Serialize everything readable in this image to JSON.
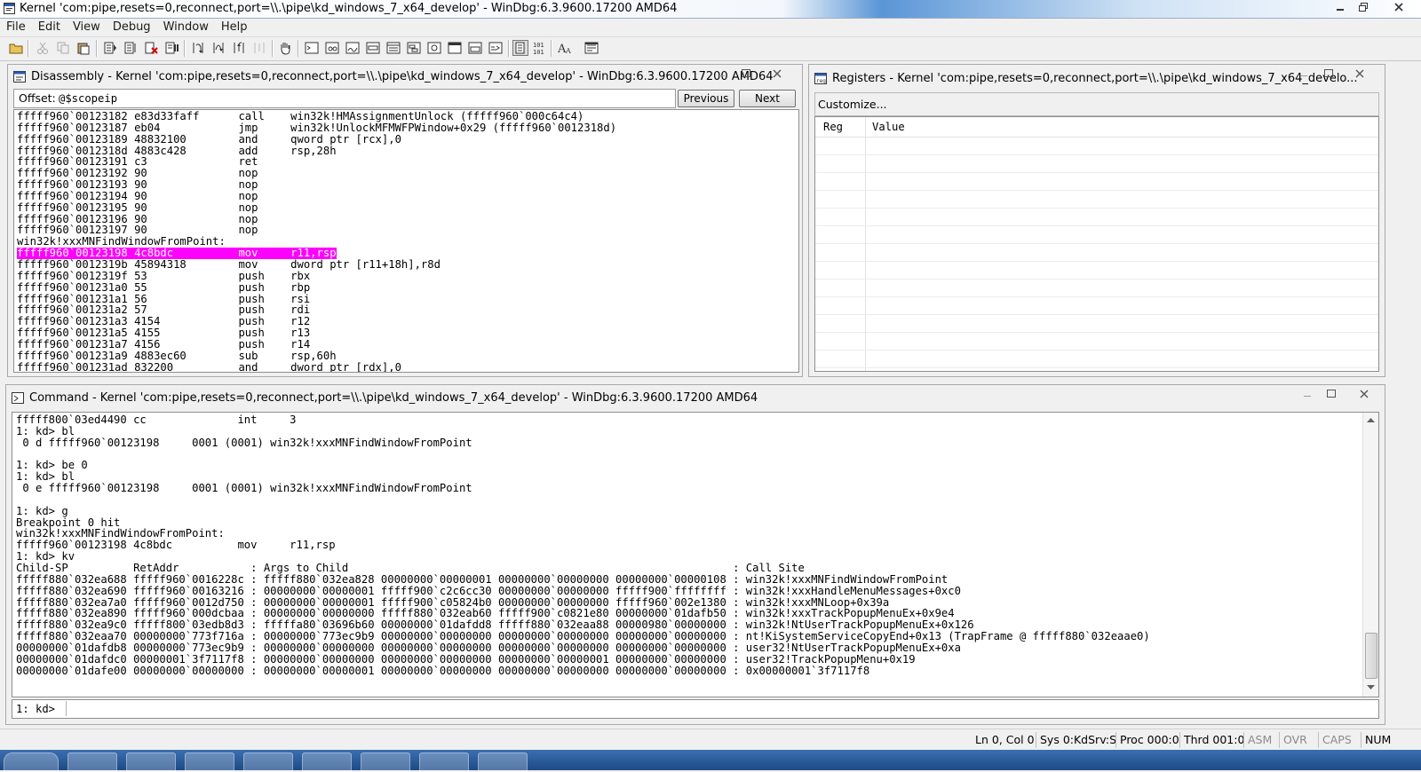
{
  "app": {
    "title": "Kernel 'com:pipe,resets=0,reconnect,port=\\\\.\\pipe\\kd_windows_7_x64_develop' - WinDbg:6.3.9600.17200 AMD64"
  },
  "menu": [
    "File",
    "Edit",
    "View",
    "Debug",
    "Window",
    "Help"
  ],
  "disassembly": {
    "title": "Disassembly - Kernel 'com:pipe,resets=0,reconnect,port=\\\\.\\pipe\\kd_windows_7_x64_develop' - WinDbg:6.3.9600.17200 AMD64",
    "offset_label": "Offset:",
    "offset_value": "@$scopeip",
    "previous_label": "Previous",
    "next_label": "Next",
    "lines": [
      "fffff960`00123182 e83d33faff      call    win32k!HMAssignmentUnlock (fffff960`000c64c4)",
      "fffff960`00123187 eb04            jmp     win32k!UnlockMFMWFPWindow+0x29 (fffff960`0012318d)",
      "fffff960`00123189 48832100        and     qword ptr [rcx],0",
      "fffff960`0012318d 4883c428        add     rsp,28h",
      "fffff960`00123191 c3              ret",
      "fffff960`00123192 90              nop",
      "fffff960`00123193 90              nop",
      "fffff960`00123194 90              nop",
      "fffff960`00123195 90              nop",
      "fffff960`00123196 90              nop",
      "fffff960`00123197 90              nop",
      "win32k!xxxMNFindWindowFromPoint:",
      "fffff960`00123198 4c8bdc          mov     r11,rsp",
      "fffff960`0012319b 45894318        mov     dword ptr [r11+18h],r8d",
      "fffff960`0012319f 53              push    rbx",
      "fffff960`001231a0 55              push    rbp",
      "fffff960`001231a1 56              push    rsi",
      "fffff960`001231a2 57              push    rdi",
      "fffff960`001231a3 4154            push    r12",
      "fffff960`001231a5 4155            push    r13",
      "fffff960`001231a7 4156            push    r14",
      "fffff960`001231a9 4883ec60        sub     rsp,60h",
      "fffff960`001231ad 832200          and     dword ptr [rdx],0"
    ],
    "highlight_index": 12,
    "highlight_color": "#ff00ff"
  },
  "registers": {
    "title": "Registers - Kernel 'com:pipe,resets=0,reconnect,port=\\\\.\\pipe\\kd_windows_7_x64_develo...",
    "customize_label": "Customize...",
    "col_reg": "Reg",
    "col_value": "Value"
  },
  "command": {
    "title": "Command - Kernel 'com:pipe,resets=0,reconnect,port=\\\\.\\pipe\\kd_windows_7_x64_develop' - WinDbg:6.3.9600.17200 AMD64",
    "lines": [
      "fffff800`03ed4490 cc              int     3",
      "1: kd> bl",
      " 0 d fffff960`00123198     0001 (0001) win32k!xxxMNFindWindowFromPoint",
      "",
      "1: kd> be 0",
      "1: kd> bl",
      " 0 e fffff960`00123198     0001 (0001) win32k!xxxMNFindWindowFromPoint",
      "",
      "1: kd> g",
      "Breakpoint 0 hit",
      "win32k!xxxMNFindWindowFromPoint:",
      "fffff960`00123198 4c8bdc          mov     r11,rsp",
      "1: kd> kv",
      "Child-SP          RetAddr           : Args to Child                                                           : Call Site",
      "fffff880`032ea688 fffff960`0016228c : fffff880`032ea828 00000000`00000001 00000000`00000000 00000000`00000108 : win32k!xxxMNFindWindowFromPoint",
      "fffff880`032ea690 fffff960`00163216 : 00000000`00000001 fffff900`c2c6cc30 00000000`00000000 fffff900`ffffffff : win32k!xxxHandleMenuMessages+0xc0",
      "fffff880`032ea7a0 fffff960`0012d750 : 00000000`00000001 fffff900`c05824b0 00000000`00000000 fffff960`002e1380 : win32k!xxxMNLoop+0x39a",
      "fffff880`032ea890 fffff960`000dcbaa : 00000000`00000000 fffff880`032eab60 fffff900`c0821e80 00000000`01dafb50 : win32k!xxxTrackPopupMenuEx+0x9e4",
      "fffff880`032ea9c0 fffff800`03edb8d3 : fffffa80`03696b60 00000000`01dafdd8 fffff880`032eaa88 00000980`00000000 : win32k!NtUserTrackPopupMenuEx+0x126",
      "fffff880`032eaa70 00000000`773f716a : 00000000`773ec9b9 00000000`00000000 00000000`00000000 00000000`00000000 : nt!KiSystemServiceCopyEnd+0x13 (TrapFrame @ fffff880`032eaae0)",
      "00000000`01dafdb8 00000000`773ec9b9 : 00000000`00000000 00000000`00000000 00000000`00000000 00000000`00000000 : user32!NtUserTrackPopupMenuEx+0xa",
      "00000000`01dafdc0 00000001`3f7117f8 : 00000000`00000000 00000000`00000000 00000000`00000001 00000000`00000000 : user32!TrackPopupMenu+0x19",
      "00000000`01dafe00 00000000`00000000 : 00000000`00000001 00000000`00000000 00000000`00000000 00000000`00000000 : 0x00000001`3f7117f8"
    ],
    "prompt": "1: kd>"
  },
  "status": {
    "position": "Ln 0, Col 0",
    "sys": "Sys 0:KdSrv:S",
    "proc": "Proc 000:0",
    "thrd": "Thrd 001:0",
    "asm": "ASM",
    "ovr": "OVR",
    "caps": "CAPS",
    "num": "NUM"
  },
  "colors": {
    "highlight": "#ff00ff",
    "taskbar": "#2a5a9a"
  }
}
